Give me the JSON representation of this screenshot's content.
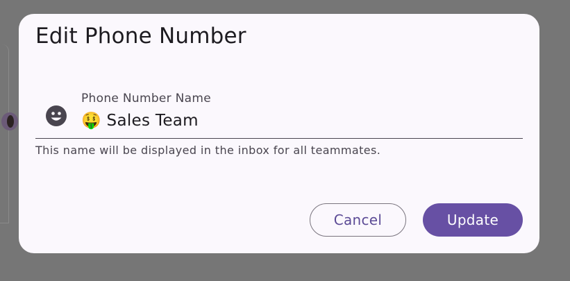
{
  "dialog": {
    "title": "Edit Phone Number",
    "field": {
      "label": "Phone Number Name",
      "value": "🤑 Sales Team",
      "leading_icon": "emoji-picker-icon",
      "helper_text": "This name will be displayed in the inbox for all teammates."
    },
    "actions": {
      "cancel_label": "Cancel",
      "update_label": "Update"
    }
  },
  "colors": {
    "scrim": "#767676",
    "surface": "#fbf8fd",
    "primary": "#6750a4",
    "on_surface": "#1d1b20",
    "on_surface_variant": "#49454f",
    "outline": "#79747e"
  }
}
